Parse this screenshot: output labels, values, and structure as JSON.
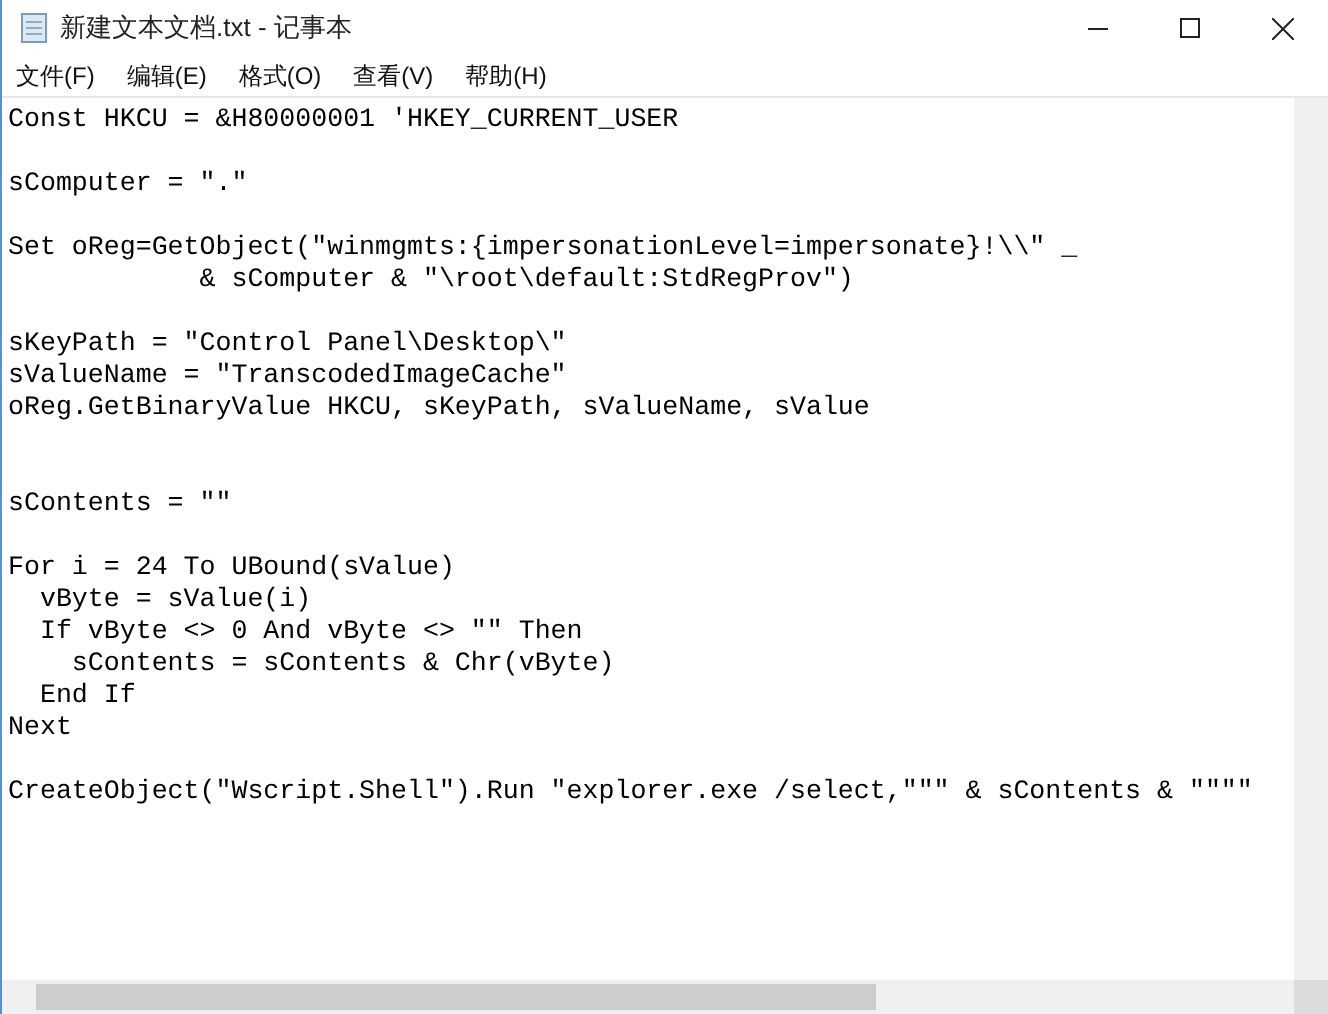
{
  "window": {
    "title": "新建文本文档.txt - 记事本"
  },
  "menu": [
    "文件(F)",
    "编辑(E)",
    "格式(O)",
    "查看(V)",
    "帮助(H)"
  ],
  "editor": {
    "lines": [
      {
        "kind": "code",
        "text": "Const HKCU = &H80000001 'HKEY_CURRENT_USER"
      },
      {
        "kind": "blank"
      },
      {
        "kind": "code",
        "text": "sComputer = \".\""
      },
      {
        "kind": "blank"
      },
      {
        "kind": "code",
        "text": "Set oReg=GetObject(\"winmgmts:{impersonationLevel=impersonate}!\\\\\" _"
      },
      {
        "kind": "code",
        "text": "            & sComputer & \"\\root\\default:StdRegProv\")"
      },
      {
        "kind": "blank"
      },
      {
        "kind": "code",
        "text": "sKeyPath = \"Control Panel\\Desktop\\\""
      },
      {
        "kind": "code",
        "text": "sValueName = \"TranscodedImageCache\""
      },
      {
        "kind": "code",
        "text": "oReg.GetBinaryValue HKCU, sKeyPath, sValueName, sValue"
      },
      {
        "kind": "blank"
      },
      {
        "kind": "blank"
      },
      {
        "kind": "code",
        "text": "sContents = \"\""
      },
      {
        "kind": "blank"
      },
      {
        "kind": "code",
        "text": "For i = 24 To UBound(sValue)"
      },
      {
        "kind": "code",
        "text": "  vByte = sValue(i)"
      },
      {
        "kind": "code",
        "text": "  If vByte <> 0 And vByte <> \"\" Then"
      },
      {
        "kind": "code",
        "text": "    sContents = sContents & Chr(vByte)"
      },
      {
        "kind": "code",
        "text": "  End If"
      },
      {
        "kind": "code",
        "text": "Next"
      },
      {
        "kind": "blank"
      },
      {
        "kind": "code",
        "text": "CreateObject(\"Wscript.Shell\").Run \"explorer.exe /select,\"\"\" & sContents & \"\"\"\""
      }
    ]
  }
}
